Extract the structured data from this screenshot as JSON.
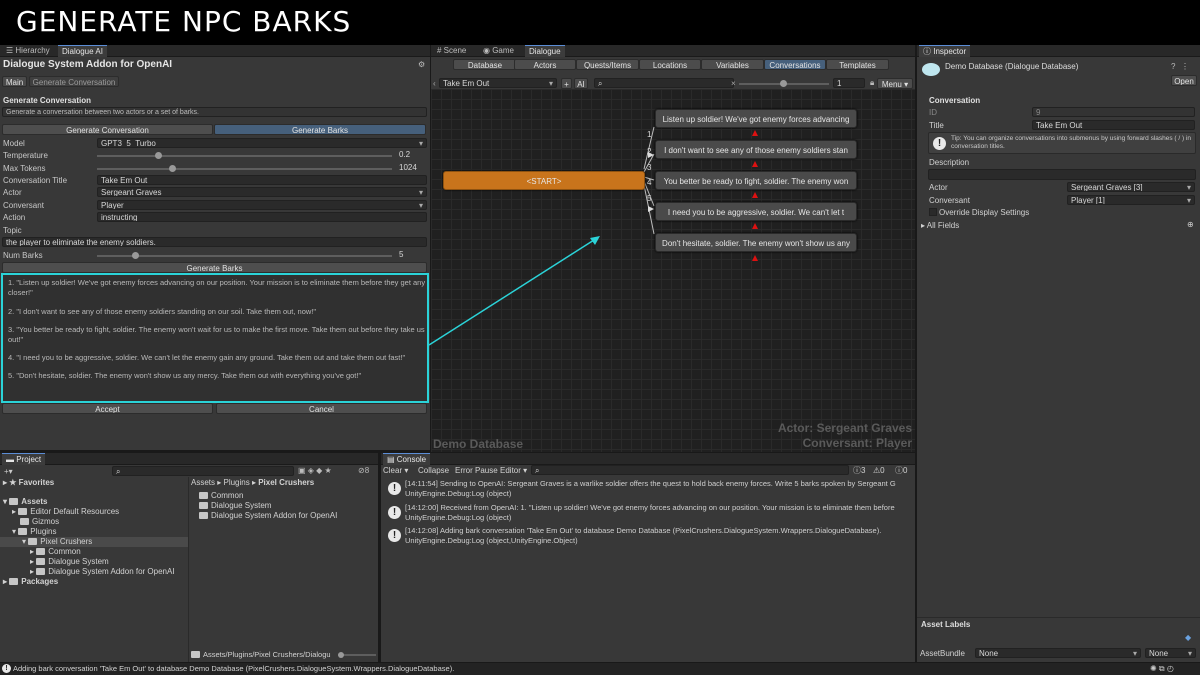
{
  "banner": {
    "title": "GENERATE NPC BARKS"
  },
  "left": {
    "tabs": [
      "Hierarchy",
      "Dialogue AI"
    ],
    "header_title": "Dialogue System Addon for OpenAI",
    "subtabs": [
      "Main",
      "Generate Conversation"
    ],
    "section_title": "Generate Conversation",
    "section_desc": "Generate a conversation between two actors or a set of barks.",
    "mode_buttons": [
      "Generate Conversation",
      "Generate Barks"
    ],
    "fields": {
      "model_label": "Model",
      "model_value": "GPT3_5_Turbo",
      "temperature_label": "Temperature",
      "temperature_value": "0.2",
      "max_tokens_label": "Max Tokens",
      "max_tokens_value": "1024",
      "title_label": "Conversation Title",
      "title_value": "Take Em Out",
      "actor_label": "Actor",
      "actor_value": "Sergeant Graves",
      "conversant_label": "Conversant",
      "conversant_value": "Player",
      "action_label": "Action",
      "action_value": "instructing",
      "topic_label": "Topic",
      "topic_value": "the player to eliminate the enemy soldiers.",
      "num_barks_label": "Num Barks",
      "num_barks_value": "5"
    },
    "sliders": {
      "temperature": 0.2,
      "max_tokens": 0.25,
      "num_barks": 0.12
    },
    "generate_barks_button": "Generate Barks",
    "barks": [
      "1. \"Listen up soldier! We've got enemy forces advancing on our position. Your mission is to eliminate them before they get any closer!\"",
      "2. \"I don't want to see any of those enemy soldiers standing on our soil. Take them out, now!\"",
      "3. \"You better be ready to fight, soldier. The enemy won't wait for us to make the first move. Take them out before they take us out!\"",
      "4. \"I need you to be aggressive, soldier. We can't let the enemy gain any ground. Take them out and take them out fast!\"",
      "5. \"Don't hesitate, soldier. The enemy won't show us any mercy. Take them out with everything you've got!\""
    ],
    "accept_button": "Accept",
    "cancel_button": "Cancel"
  },
  "center": {
    "tabs": [
      "Scene",
      "Game",
      "Dialogue"
    ],
    "subtabs": [
      "Database",
      "Actors",
      "Quests/Items",
      "Locations",
      "Variables",
      "Conversations",
      "Templates"
    ],
    "conversation_select": "Take Em Out",
    "ai_label": "AI",
    "zoom_value": "1",
    "menu_label": "Menu",
    "start_node": "<START>",
    "nodes": [
      "Listen up soldier! We've got enemy forces advancing",
      "I don't want to see any of those enemy soldiers stan",
      "You better be ready to fight, soldier. The enemy won",
      "I need you to be aggressive, soldier. We can't let t",
      "Don't hesitate, soldier. The enemy won't show us any"
    ],
    "link_numbers": [
      "1",
      "2",
      "3",
      "4",
      "5"
    ],
    "watermark_db": "Demo Database",
    "watermark_actor": "Actor: Sergeant Graves",
    "watermark_conversant": "Conversant: Player"
  },
  "inspector": {
    "tab": "Inspector",
    "title": "Demo Database (Dialogue Database)",
    "open_button": "Open",
    "section": "Conversation",
    "id_label": "ID",
    "id_value": "9",
    "title_label": "Title",
    "title_value": "Take Em Out",
    "tip": "Tip: You can organize conversations into submenus by using forward slashes ( / ) in conversation titles.",
    "description_label": "Description",
    "actor_label": "Actor",
    "actor_value": "Sergeant Graves [3]",
    "conversant_label": "Conversant",
    "conversant_value": "Player [1]",
    "override_label": "Override Display Settings",
    "all_fields": "All Fields",
    "asset_labels": "Asset Labels",
    "asset_bundle_label": "AssetBundle",
    "asset_bundle_value": "None",
    "asset_variant_value": "None"
  },
  "project": {
    "tab": "Project",
    "favorites": "Favorites",
    "tree": [
      "Assets",
      "Editor Default Resources",
      "Gizmos",
      "Plugins",
      "Pixel Crushers",
      "Common",
      "Dialogue System",
      "Dialogue System Addon for OpenAI",
      "Packages"
    ],
    "breadcrumb": [
      "Assets",
      "Plugins",
      "Pixel Crushers"
    ],
    "files": [
      "Common",
      "Dialogue System",
      "Dialogue System Addon for OpenAI"
    ],
    "path": "Assets/Plugins/Pixel Crushers/Dialogu",
    "hidden_count": "8"
  },
  "console": {
    "tab": "Console",
    "toolbar": [
      "Clear",
      "Collapse",
      "Error Pause",
      "Editor"
    ],
    "counts": [
      "3",
      "0",
      "0"
    ],
    "logs": [
      {
        "line1": "[14:11:54] Sending to OpenAI: Sergeant Graves is a warlike soldier offers the quest to hold back enemy forces. Write 5 barks spoken by Sergeant G",
        "line2": "UnityEngine.Debug:Log (object)"
      },
      {
        "line1": "[14:12:00] Received from OpenAI: 1. \"Listen up soldier! We've got enemy forces advancing on our position. Your mission is to eliminate them before",
        "line2": "UnityEngine.Debug:Log (object)"
      },
      {
        "line1": "[14:12:08] Adding bark conversation 'Take Em Out' to database Demo Database (PixelCrushers.DialogueSystem.Wrappers.DialogueDatabase).",
        "line2": "UnityEngine.Debug:Log (object,UnityEngine.Object)"
      }
    ]
  },
  "status_bar": "Adding bark conversation 'Take Em Out' to database Demo Database (PixelCrushers.DialogueSystem.Wrappers.DialogueDatabase).",
  "colors": {
    "highlight": "#2bd3d8",
    "start_node": "#c8741c",
    "active_button": "#46607c",
    "arrow": "#dd1111"
  }
}
